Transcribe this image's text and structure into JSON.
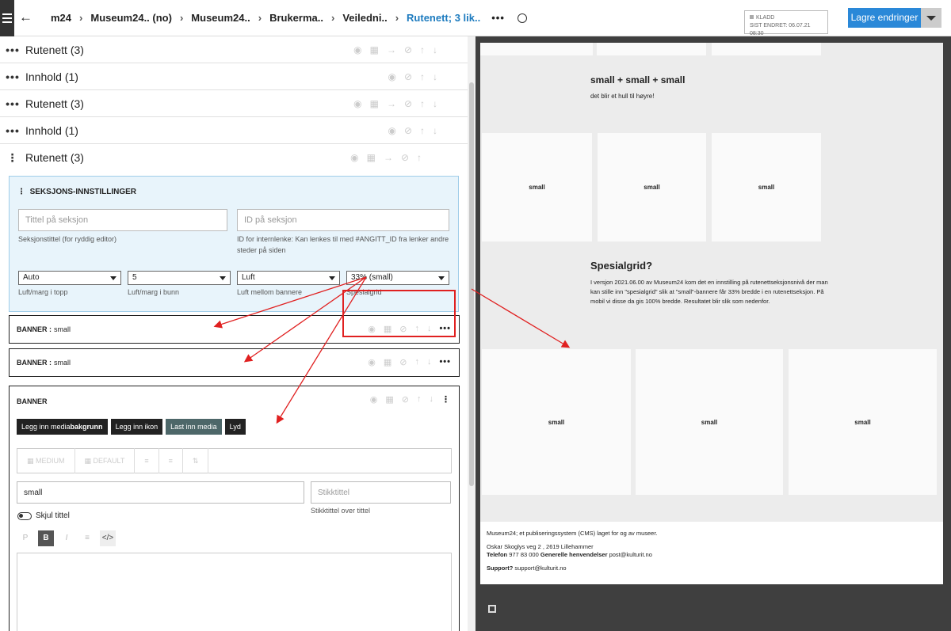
{
  "header": {
    "back_icon": "arrow-left-icon",
    "breadcrumbs": [
      "m24",
      "Museum24.. (no)",
      "Museum24..",
      "Brukerma..",
      "Veiledni..",
      "Rutenett; 3 lik.."
    ],
    "status_label": "KLADD",
    "status_changed": "SIST ENDRET: 06.07.21 08:30",
    "save_label": "Lagre endringer"
  },
  "rows": [
    {
      "label": "Rutenett (3)"
    },
    {
      "label": "Innhold (1)"
    },
    {
      "label": "Rutenett (3)"
    },
    {
      "label": "Innhold (1)"
    },
    {
      "label": "Rutenett (3)"
    }
  ],
  "section_settings": {
    "title": "SEKSJONS-INNSTILLINGER",
    "title_placeholder": "Tittel på seksjon",
    "title_help": "Seksjonstittel (for ryddig editor)",
    "id_placeholder": "ID på seksjon",
    "id_help_1": "ID for internlenke: Kan lenkes til med #ANGITT_ID fra lenker andre",
    "id_help_2": "steder på siden",
    "top_value": "Auto",
    "top_label": "Luft/marg i topp",
    "bottom_value": "5",
    "bottom_label": "Luft/marg i bunn",
    "gap_value": "Luft",
    "gap_label": "Luft mellom bannere",
    "grid_value": "33% (small)",
    "grid_label": "Spesialgrid"
  },
  "banners": [
    {
      "label": "BANNER :",
      "name": "small"
    },
    {
      "label": "BANNER :",
      "name": "small"
    }
  ],
  "banner_edit": {
    "label": "BANNER",
    "btn_media_bg_1": "Legg inn media",
    "btn_media_bg_2": "bakgrunn",
    "btn_icon": "Legg inn ikon",
    "btn_last_media": "Last inn media",
    "btn_sound": "Lyd",
    "tb_medium": "MEDIUM",
    "tb_default": "DEFAULT",
    "title_value": "small",
    "stikk_placeholder": "Stikktittel",
    "stikk_help": "Stikktittel over tittel",
    "hide_title": "Skjul tittel",
    "fmt_p": "P",
    "fmt_b": "B",
    "fmt_i": "I"
  },
  "preview": {
    "heading1": "small + small + small",
    "sub1": "det blir et hull til høyre!",
    "card_label": "small",
    "heading2": "Spesialgrid?",
    "para2": "I versjon 2021.06.00 av Museum24 kom det en innstilling på rutenettseksjonsnivå der man kan stille inn \"spesialgrid\" slik at \"small\"-bannere får 33% bredde i en rutenettseksjon. På mobil vi disse da gis 100% bredde.  Resultatet blir slik som nedenfor.",
    "footer_line1": "Museum24; et publiseringssystem (CMS) laget for og av museer.",
    "footer_address": "Oskar Skoglys veg 2 , 2619 Lillehammer",
    "footer_phone_label": "Telefon",
    "footer_phone": "977 83 000",
    "footer_gen_label": "Generelle henvendelser",
    "footer_email": "post@kulturit.no",
    "footer_support_label": "Support?",
    "footer_support": "support@kulturit.no"
  },
  "colors": {
    "accent": "#1d7bbf",
    "save": "#2a88d8",
    "settings_bg": "#e8f4fb",
    "annotation": "#e02020"
  }
}
